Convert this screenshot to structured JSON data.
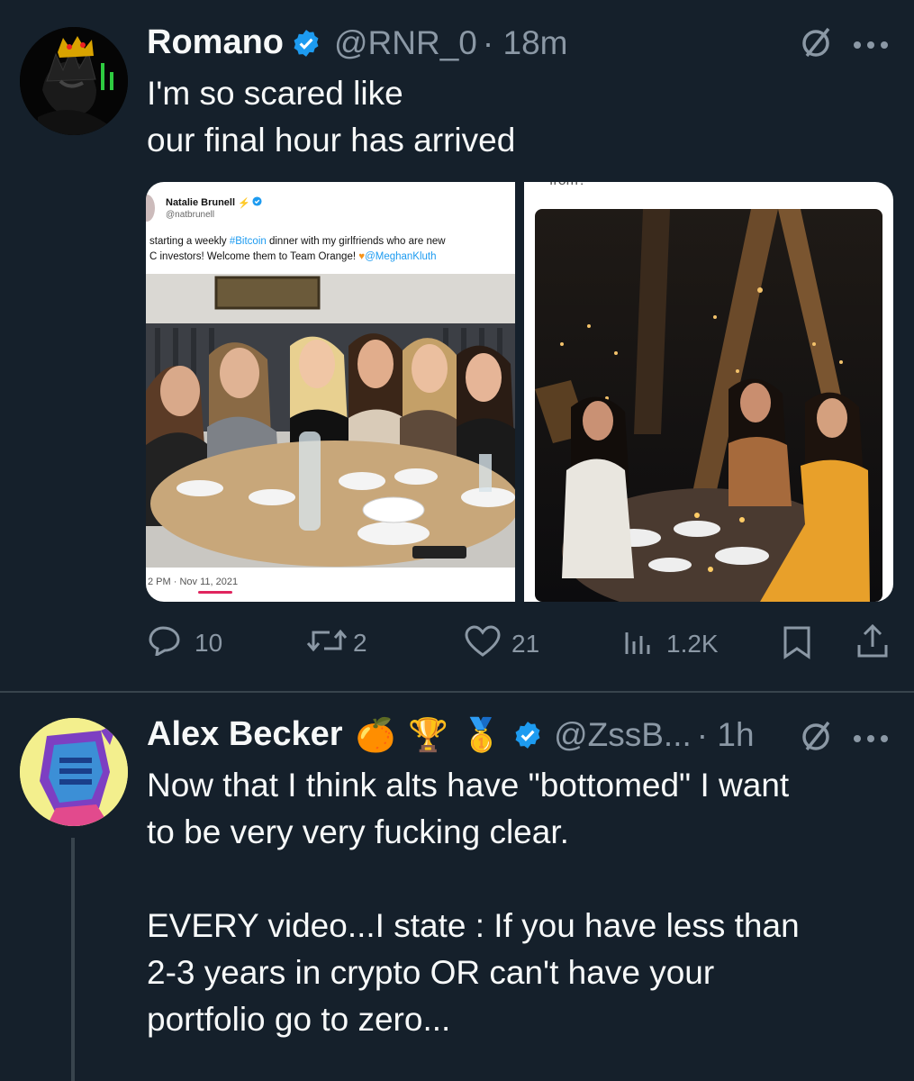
{
  "tweet1": {
    "name": "Romano",
    "handle": "@RNR_0",
    "time": "· 18m",
    "text": "I'm so scared like\nour final hour has arrived",
    "embed_left": {
      "name": "Natalie Brunell",
      "handle": "@natbrunell",
      "text_plain1": "starting a weekly ",
      "hashtag": "#Bitcoin",
      "text_plain2": " dinner with my girlfriends who are new",
      "text_line2": "C investors! Welcome them to Team Orange! ",
      "mention": "@MeghanKluth",
      "timestamp": "2 PM · Nov 11, 2021"
    },
    "embed_right_top_text": "from?",
    "metrics": {
      "replies": "10",
      "reposts": "2",
      "likes": "21",
      "views": "1.2K"
    }
  },
  "tweet2": {
    "name": "Alex Becker",
    "emojis": "🍊 🏆 🥇",
    "handle": "@ZssB...",
    "time": "· 1h",
    "text": "Now that I think alts have \"bottomed\" I want\nto be very very fucking clear.\n\nEVERY video...I state : If you have less than\n2-3 years in crypto OR can't have your\nportfolio go to zero..."
  },
  "colors": {
    "background": "#15202b",
    "accent": "#1d9bf0",
    "muted": "#8b98a5",
    "divider": "#38444d"
  }
}
